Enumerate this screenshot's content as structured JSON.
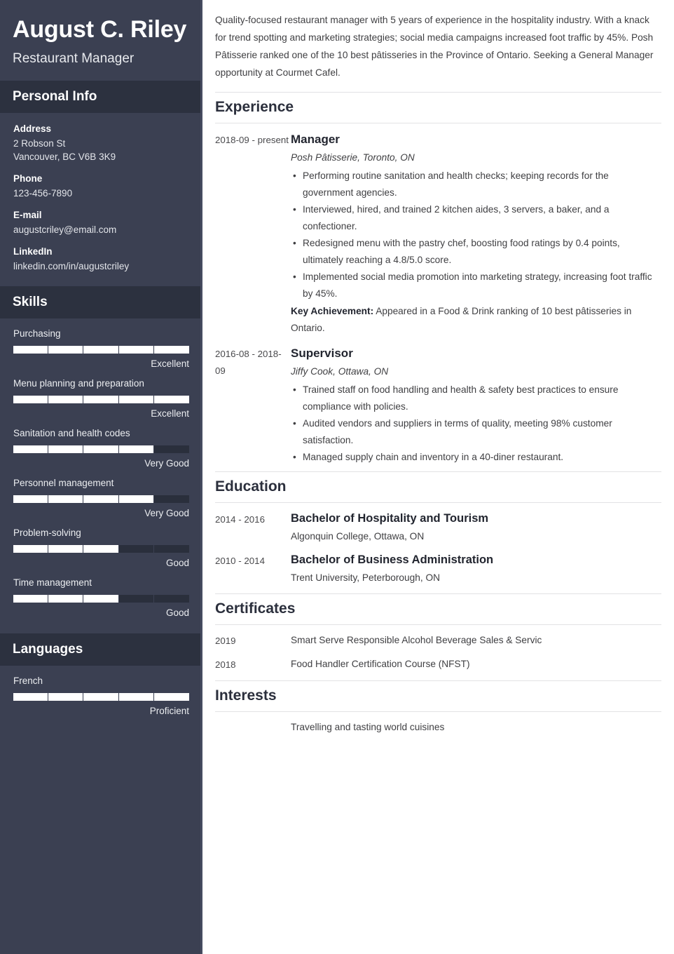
{
  "header": {
    "name": "August C. Riley",
    "job_title": "Restaurant Manager"
  },
  "sidebar": {
    "personal_info": {
      "heading": "Personal Info",
      "items": [
        {
          "label": "Address",
          "lines": [
            "2 Robson St",
            "Vancouver, BC V6B 3K9"
          ]
        },
        {
          "label": "Phone",
          "lines": [
            "123-456-7890"
          ]
        },
        {
          "label": "E-mail",
          "lines": [
            "augustcriley@email.com"
          ]
        },
        {
          "label": "LinkedIn",
          "lines": [
            "linkedin.com/in/augustcriley"
          ]
        }
      ]
    },
    "skills": {
      "heading": "Skills",
      "items": [
        {
          "name": "Purchasing",
          "level": "Excellent",
          "filled": 5,
          "total": 5
        },
        {
          "name": "Menu planning and preparation",
          "level": "Excellent",
          "filled": 5,
          "total": 5
        },
        {
          "name": "Sanitation and health codes",
          "level": "Very Good",
          "filled": 4,
          "total": 5
        },
        {
          "name": "Personnel management",
          "level": "Very Good",
          "filled": 4,
          "total": 5
        },
        {
          "name": "Problem-solving",
          "level": "Good",
          "filled": 3,
          "total": 5
        },
        {
          "name": "Time management",
          "level": "Good",
          "filled": 3,
          "total": 5
        }
      ]
    },
    "languages": {
      "heading": "Languages",
      "items": [
        {
          "name": "French",
          "level": "Proficient",
          "filled": 5,
          "total": 5
        }
      ]
    }
  },
  "main": {
    "summary": "Quality-focused restaurant manager with 5 years of experience in the hospitality industry. With a knack for trend spotting and marketing strategies; social media campaigns increased foot traffic by 45%. Posh Pâtisserie ranked one of the 10 best pâtisseries in the Province of Ontario. Seeking a General Manager opportunity at Courmet Cafel.",
    "experience": {
      "heading": "Experience",
      "entries": [
        {
          "date": "2018-09 - present",
          "role": "Manager",
          "org": "Posh Pâtisserie, Toronto, ON",
          "bullets": [
            "Performing routine sanitation and health checks; keeping records for the government agencies.",
            "Interviewed, hired, and trained 2 kitchen aides, 3 servers, a baker, and a confectioner.",
            "Redesigned menu with the pastry chef, boosting food ratings by 0.4 points, ultimately reaching a 4.8/5.0 score.",
            "Implemented social media promotion into marketing strategy, increasing foot traffic by 45%."
          ],
          "key_achievement_label": "Key Achievement:",
          "key_achievement_text": "Appeared in a Food & Drink ranking of 10 best pâtisseries in Ontario."
        },
        {
          "date": "2016-08 - 2018-09",
          "role": "Supervisor",
          "org": "Jiffy Cook, Ottawa, ON",
          "bullets": [
            "Trained staff on food handling and health & safety best practices to ensure compliance with policies.",
            "Audited vendors and suppliers in terms of quality, meeting 98% customer satisfaction.",
            "Managed supply chain and inventory in a 40-diner restaurant."
          ],
          "key_achievement_label": "",
          "key_achievement_text": ""
        }
      ]
    },
    "education": {
      "heading": "Education",
      "entries": [
        {
          "date": "2014 - 2016",
          "degree": "Bachelor of Hospitality and Tourism",
          "school": "Algonquin College, Ottawa, ON"
        },
        {
          "date": "2010 - 2014",
          "degree": "Bachelor of Business Administration",
          "school": "Trent University, Peterborough, ON"
        }
      ]
    },
    "certificates": {
      "heading": "Certificates",
      "entries": [
        {
          "date": "2019",
          "text": "Smart Serve Responsible Alcohol Beverage Sales & Servic"
        },
        {
          "date": "2018",
          "text": "Food Handler Certification Course (NFST)"
        }
      ]
    },
    "interests": {
      "heading": "Interests",
      "entries": [
        {
          "date": "",
          "text": "Travelling and tasting world cuisines"
        }
      ]
    }
  },
  "colors": {
    "sidebar_bg": "#3b4052",
    "sidebar_head_bg": "#2c313f",
    "sidebar_edge": "#464c60",
    "bar_fill": "#ffffff",
    "bar_track": "#2a2f3c",
    "main_text": "#3f3f42",
    "heading_text": "#2b2f3c",
    "rule": "#e2e2e4"
  }
}
